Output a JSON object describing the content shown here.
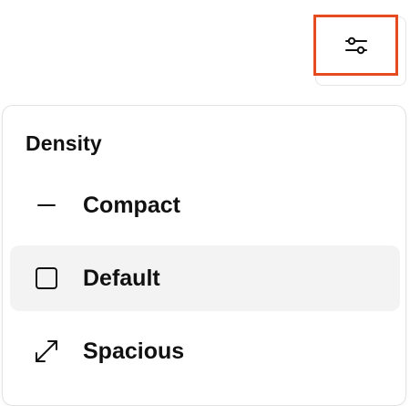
{
  "toolbar": {
    "settings_icon": "sliders-icon"
  },
  "density_menu": {
    "title": "Density",
    "selected": "Default",
    "items": [
      {
        "label": "Compact",
        "icon": "minus-icon"
      },
      {
        "label": "Default",
        "icon": "square-icon"
      },
      {
        "label": "Spacious",
        "icon": "expand-arrows-icon"
      }
    ]
  },
  "colors": {
    "highlight_border": "#e64a1f",
    "selected_bg": "#f3f3f3"
  }
}
